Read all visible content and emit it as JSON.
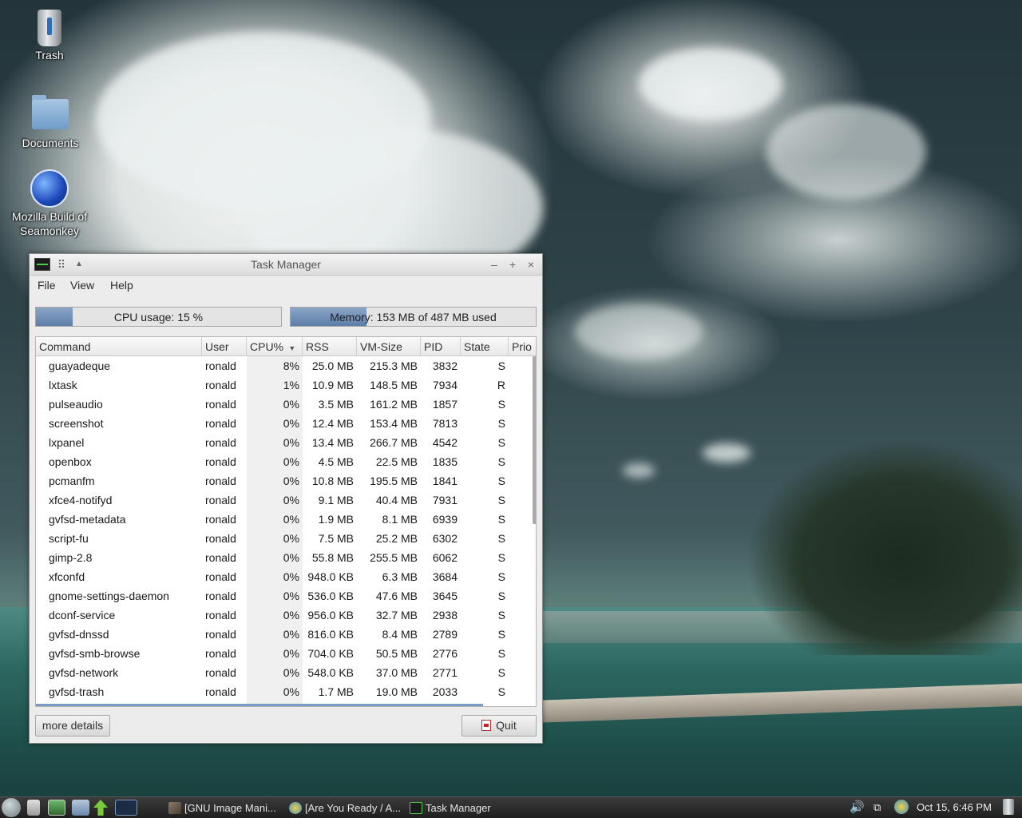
{
  "desktop": {
    "icons": [
      {
        "label": "Trash",
        "icon": "trash-icon"
      },
      {
        "label": "Documents",
        "icon": "folder-icon"
      },
      {
        "label": "Mozilla Build of Seamonkey",
        "icon": "seamonkey-icon"
      }
    ]
  },
  "window": {
    "title": "Task Manager",
    "controls": {
      "minimize": "–",
      "maximize": "+",
      "close": "×"
    },
    "menu": [
      "File",
      "View",
      "Help"
    ],
    "cpu": {
      "label": "CPU usage: 15 %",
      "percent": 15
    },
    "memory": {
      "label": "Memory: 153 MB of 487 MB used",
      "percent": 31
    },
    "columns": [
      "Command",
      "User",
      "CPU%",
      "RSS",
      "VM-Size",
      "PID",
      "State",
      "Prio"
    ],
    "sort_column": "CPU%",
    "rows": [
      {
        "command": "guayadeque",
        "user": "ronald",
        "cpu": "8%",
        "rss": "25.0 MB",
        "vm": "215.3 MB",
        "pid": "3832",
        "state": "S"
      },
      {
        "command": "lxtask",
        "user": "ronald",
        "cpu": "1%",
        "rss": "10.9 MB",
        "vm": "148.5 MB",
        "pid": "7934",
        "state": "R"
      },
      {
        "command": "pulseaudio",
        "user": "ronald",
        "cpu": "0%",
        "rss": "3.5 MB",
        "vm": "161.2 MB",
        "pid": "1857",
        "state": "S"
      },
      {
        "command": "screenshot",
        "user": "ronald",
        "cpu": "0%",
        "rss": "12.4 MB",
        "vm": "153.4 MB",
        "pid": "7813",
        "state": "S"
      },
      {
        "command": "lxpanel",
        "user": "ronald",
        "cpu": "0%",
        "rss": "13.4 MB",
        "vm": "266.7 MB",
        "pid": "4542",
        "state": "S"
      },
      {
        "command": "openbox",
        "user": "ronald",
        "cpu": "0%",
        "rss": "4.5 MB",
        "vm": "22.5 MB",
        "pid": "1835",
        "state": "S"
      },
      {
        "command": "pcmanfm",
        "user": "ronald",
        "cpu": "0%",
        "rss": "10.8 MB",
        "vm": "195.5 MB",
        "pid": "1841",
        "state": "S"
      },
      {
        "command": "xfce4-notifyd",
        "user": "ronald",
        "cpu": "0%",
        "rss": "9.1 MB",
        "vm": "40.4 MB",
        "pid": "7931",
        "state": "S"
      },
      {
        "command": "gvfsd-metadata",
        "user": "ronald",
        "cpu": "0%",
        "rss": "1.9 MB",
        "vm": "8.1 MB",
        "pid": "6939",
        "state": "S"
      },
      {
        "command": "script-fu",
        "user": "ronald",
        "cpu": "0%",
        "rss": "7.5 MB",
        "vm": "25.2 MB",
        "pid": "6302",
        "state": "S"
      },
      {
        "command": "gimp-2.8",
        "user": "ronald",
        "cpu": "0%",
        "rss": "55.8 MB",
        "vm": "255.5 MB",
        "pid": "6062",
        "state": "S"
      },
      {
        "command": "xfconfd",
        "user": "ronald",
        "cpu": "0%",
        "rss": "948.0 KB",
        "vm": "6.3 MB",
        "pid": "3684",
        "state": "S"
      },
      {
        "command": "gnome-settings-daemon",
        "user": "ronald",
        "cpu": "0%",
        "rss": "536.0 KB",
        "vm": "47.6 MB",
        "pid": "3645",
        "state": "S"
      },
      {
        "command": "dconf-service",
        "user": "ronald",
        "cpu": "0%",
        "rss": "956.0 KB",
        "vm": "32.7 MB",
        "pid": "2938",
        "state": "S"
      },
      {
        "command": "gvfsd-dnssd",
        "user": "ronald",
        "cpu": "0%",
        "rss": "816.0 KB",
        "vm": "8.4 MB",
        "pid": "2789",
        "state": "S"
      },
      {
        "command": "gvfsd-smb-browse",
        "user": "ronald",
        "cpu": "0%",
        "rss": "704.0 KB",
        "vm": "50.5 MB",
        "pid": "2776",
        "state": "S"
      },
      {
        "command": "gvfsd-network",
        "user": "ronald",
        "cpu": "0%",
        "rss": "548.0 KB",
        "vm": "37.0 MB",
        "pid": "2771",
        "state": "S"
      },
      {
        "command": "gvfsd-trash",
        "user": "ronald",
        "cpu": "0%",
        "rss": "1.7 MB",
        "vm": "19.0 MB",
        "pid": "2033",
        "state": "S"
      }
    ],
    "more_details": "more details",
    "quit": "Quit"
  },
  "taskbar": {
    "tasks": [
      {
        "label": "[GNU Image Mani...",
        "icon": "gimp-icon"
      },
      {
        "label": "[Are You Ready / A...",
        "icon": "guayadeque-icon"
      },
      {
        "label": "Task Manager",
        "icon": "task-manager-icon"
      }
    ],
    "clock": "Oct 15, 6:46 PM"
  }
}
